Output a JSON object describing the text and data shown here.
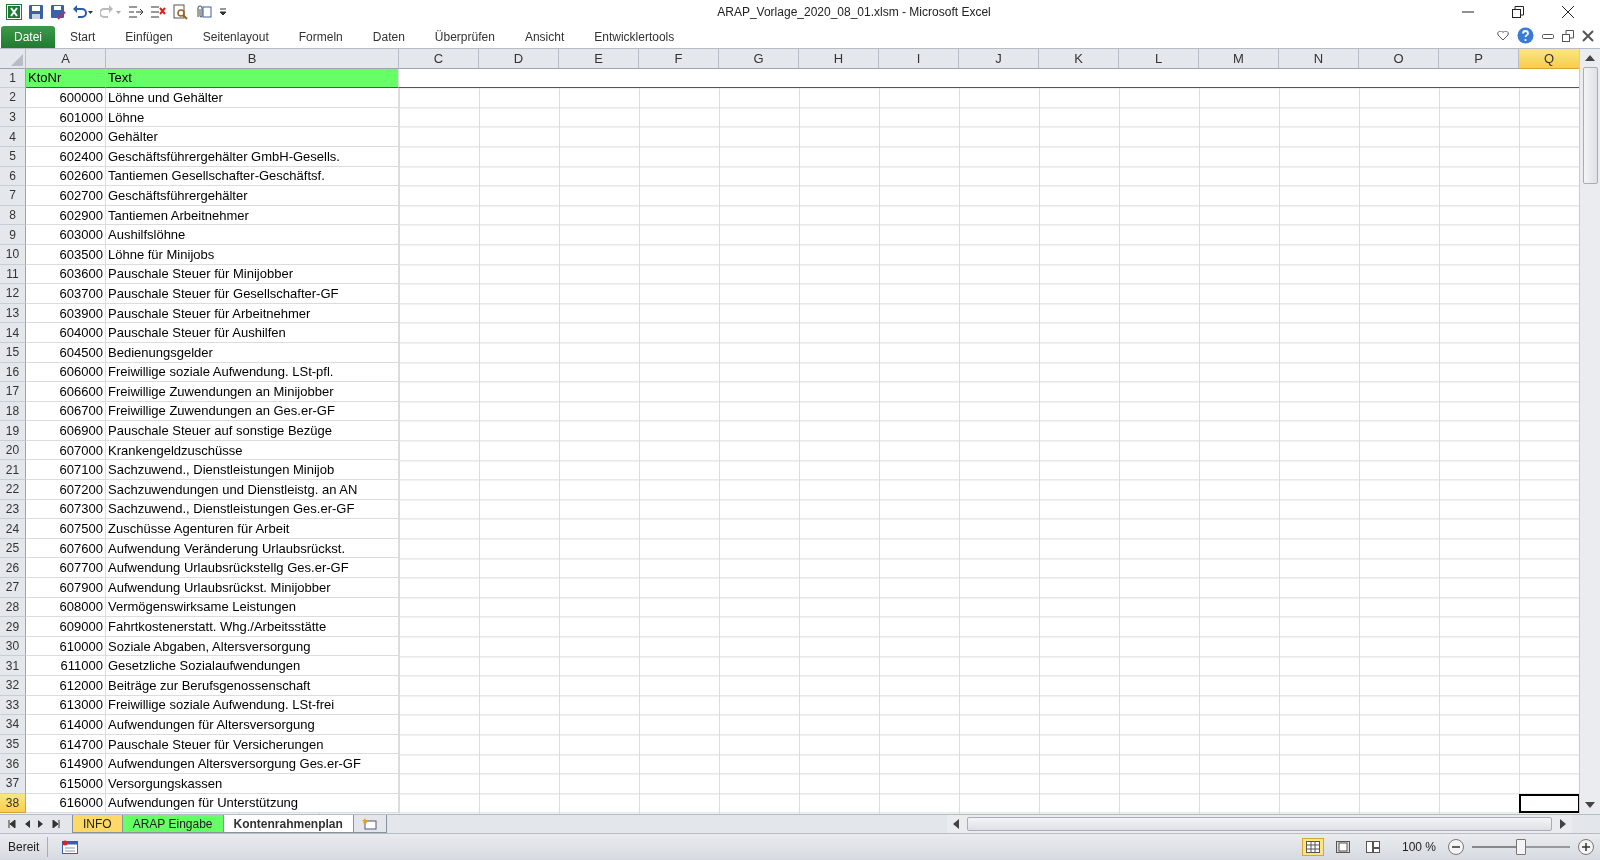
{
  "window": {
    "title": "ARAP_Vorlage_2020_08_01.xlsm - Microsoft Excel"
  },
  "ribbon_tabs": [
    {
      "label": "Datei",
      "selected": true
    },
    {
      "label": "Start",
      "selected": false
    },
    {
      "label": "Einfügen",
      "selected": false
    },
    {
      "label": "Seitenlayout",
      "selected": false
    },
    {
      "label": "Formeln",
      "selected": false
    },
    {
      "label": "Daten",
      "selected": false
    },
    {
      "label": "Überprüfen",
      "selected": false
    },
    {
      "label": "Ansicht",
      "selected": false
    },
    {
      "label": "Entwicklertools",
      "selected": false
    }
  ],
  "columns": [
    {
      "label": "A",
      "selected": false
    },
    {
      "label": "B",
      "selected": false
    },
    {
      "label": "C",
      "selected": false
    },
    {
      "label": "D",
      "selected": false
    },
    {
      "label": "E",
      "selected": false
    },
    {
      "label": "F",
      "selected": false
    },
    {
      "label": "G",
      "selected": false
    },
    {
      "label": "H",
      "selected": false
    },
    {
      "label": "I",
      "selected": false
    },
    {
      "label": "J",
      "selected": false
    },
    {
      "label": "K",
      "selected": false
    },
    {
      "label": "L",
      "selected": false
    },
    {
      "label": "M",
      "selected": false
    },
    {
      "label": "N",
      "selected": false
    },
    {
      "label": "O",
      "selected": false
    },
    {
      "label": "P",
      "selected": false
    },
    {
      "label": "Q",
      "selected": true
    }
  ],
  "header_row": {
    "num": "1",
    "kto": "KtoNr",
    "text": "Text",
    "selected": false
  },
  "rows": [
    {
      "num": "2",
      "kto": "600000",
      "text": "Löhne und Gehälter",
      "selected": false
    },
    {
      "num": "3",
      "kto": "601000",
      "text": "Löhne",
      "selected": false
    },
    {
      "num": "4",
      "kto": "602000",
      "text": "Gehälter",
      "selected": false
    },
    {
      "num": "5",
      "kto": "602400",
      "text": "Geschäftsführergehälter GmbH-Gesells.",
      "selected": false
    },
    {
      "num": "6",
      "kto": "602600",
      "text": "Tantiemen Gesellschafter-Geschäftsf.",
      "selected": false
    },
    {
      "num": "7",
      "kto": "602700",
      "text": "Geschäftsführergehälter",
      "selected": false
    },
    {
      "num": "8",
      "kto": "602900",
      "text": "Tantiemen Arbeitnehmer",
      "selected": false
    },
    {
      "num": "9",
      "kto": "603000",
      "text": "Aushilfslöhne",
      "selected": false
    },
    {
      "num": "10",
      "kto": "603500",
      "text": "Löhne für Minijobs",
      "selected": false
    },
    {
      "num": "11",
      "kto": "603600",
      "text": "Pauschale Steuer für Minijobber",
      "selected": false
    },
    {
      "num": "12",
      "kto": "603700",
      "text": "Pauschale Steuer für Gesellschafter-GF",
      "selected": false
    },
    {
      "num": "13",
      "kto": "603900",
      "text": "Pauschale Steuer für Arbeitnehmer",
      "selected": false
    },
    {
      "num": "14",
      "kto": "604000",
      "text": "Pauschale Steuer für Aushilfen",
      "selected": false
    },
    {
      "num": "15",
      "kto": "604500",
      "text": "Bedienungsgelder",
      "selected": false
    },
    {
      "num": "16",
      "kto": "606000",
      "text": "Freiwillige soziale Aufwendung. LSt-pfl.",
      "selected": false
    },
    {
      "num": "17",
      "kto": "606600",
      "text": "Freiwillige Zuwendungen an Minijobber",
      "selected": false
    },
    {
      "num": "18",
      "kto": "606700",
      "text": "Freiwillige Zuwendungen an Ges.er-GF",
      "selected": false
    },
    {
      "num": "19",
      "kto": "606900",
      "text": "Pauschale Steuer auf sonstige Bezüge",
      "selected": false
    },
    {
      "num": "20",
      "kto": "607000",
      "text": "Krankengeldzuschüsse",
      "selected": false
    },
    {
      "num": "21",
      "kto": "607100",
      "text": "Sachzuwend., Dienstleistungen Minijob",
      "selected": false
    },
    {
      "num": "22",
      "kto": "607200",
      "text": "Sachzuwendungen und Dienstleistg. an AN",
      "selected": false
    },
    {
      "num": "23",
      "kto": "607300",
      "text": "Sachzuwend., Dienstleistungen Ges.er-GF",
      "selected": false
    },
    {
      "num": "24",
      "kto": "607500",
      "text": "Zuschüsse Agenturen für Arbeit",
      "selected": false
    },
    {
      "num": "25",
      "kto": "607600",
      "text": "Aufwendung Veränderung Urlaubsrückst.",
      "selected": false
    },
    {
      "num": "26",
      "kto": "607700",
      "text": "Aufwendung Urlaubsrückstellg Ges.er-GF",
      "selected": false
    },
    {
      "num": "27",
      "kto": "607900",
      "text": "Aufwendung Urlaubsrückst. Minijobber",
      "selected": false
    },
    {
      "num": "28",
      "kto": "608000",
      "text": "Vermögenswirksame Leistungen",
      "selected": false
    },
    {
      "num": "29",
      "kto": "609000",
      "text": "Fahrtkostenerstatt. Whg./Arbeitsstätte",
      "selected": false
    },
    {
      "num": "30",
      "kto": "610000",
      "text": "Soziale Abgaben, Altersversorgung",
      "selected": false
    },
    {
      "num": "31",
      "kto": "611000",
      "text": "Gesetzliche Sozialaufwendungen",
      "selected": false
    },
    {
      "num": "32",
      "kto": "612000",
      "text": "Beiträge zur Berufsgenossenschaft",
      "selected": false
    },
    {
      "num": "33",
      "kto": "613000",
      "text": "Freiwillige soziale Aufwendung. LSt-frei",
      "selected": false
    },
    {
      "num": "34",
      "kto": "614000",
      "text": "Aufwendungen für Altersversorgung",
      "selected": false
    },
    {
      "num": "35",
      "kto": "614700",
      "text": "Pauschale Steuer für Versicherungen",
      "selected": false
    },
    {
      "num": "36",
      "kto": "614900",
      "text": "Aufwendungen Altersversorgung Ges.er-GF",
      "selected": false
    },
    {
      "num": "37",
      "kto": "615000",
      "text": "Versorgungskassen",
      "selected": false
    },
    {
      "num": "38",
      "kto": "616000",
      "text": "Aufwendungen für Unterstützung",
      "selected": true
    }
  ],
  "sheet_tabs": [
    {
      "label": "INFO",
      "selected": false,
      "color": "#ffd966"
    },
    {
      "label": "ARAP Eingabe",
      "selected": false,
      "color": "#66ff66"
    },
    {
      "label": "Kontenrahmenplan",
      "selected": true,
      "color": "#ffffff"
    }
  ],
  "status_bar": {
    "status": "Bereit",
    "zoom": "100 %",
    "level": 0.5
  }
}
